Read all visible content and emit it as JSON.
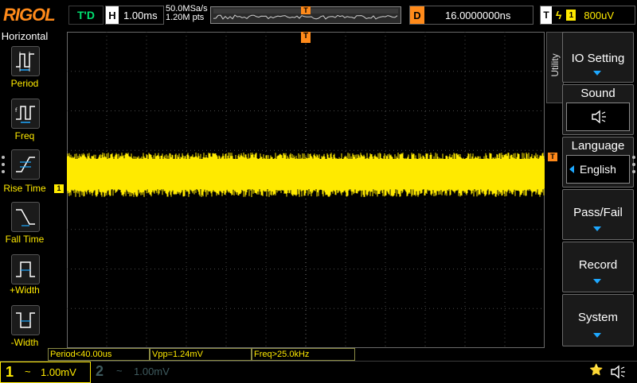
{
  "header": {
    "brand": "RIGOL",
    "run_status": "T'D",
    "timebase_tag": "H",
    "timebase": "1.00ms",
    "sample_rate": "50.0MSa/s",
    "memory_depth": "1.20M pts",
    "delay_tag": "D",
    "delay": "16.0000000ns",
    "trigger_tag": "T",
    "trigger_source": "1",
    "trigger_level": "800uV"
  },
  "measure_menu": {
    "title": "Horizontal",
    "items": [
      {
        "label": "Period",
        "icon": "period-icon"
      },
      {
        "label": "Freq",
        "icon": "frequency-icon"
      },
      {
        "label": "Rise Time",
        "icon": "rise-time-icon"
      },
      {
        "label": "Fall Time",
        "icon": "fall-time-icon"
      },
      {
        "label": "+Width",
        "icon": "positive-width-icon"
      },
      {
        "label": "-Width",
        "icon": "negative-width-icon"
      }
    ]
  },
  "display": {
    "channel_marker": "1",
    "trigger_position_marker": "T",
    "trigger_level_marker": "T",
    "trace_color": "#ffea00",
    "grid_color": "#4a4a4a",
    "grid_divisions": {
      "horizontal": 12,
      "vertical": 8
    }
  },
  "measurements": [
    {
      "text": "Period<40.00us"
    },
    {
      "text": "Vpp=1.24mV"
    },
    {
      "text": "Freq>25.0kHz"
    }
  ],
  "channels": [
    {
      "number": "1",
      "coupling": "~",
      "scale": "1.00mV",
      "active": true,
      "color": "#ffea00"
    },
    {
      "number": "2",
      "coupling": "~",
      "scale": "1.00mV",
      "active": false,
      "color": "#3e5a5e"
    }
  ],
  "utility_menu": {
    "tab_label": "Utility",
    "items": [
      {
        "label": "IO Setting",
        "has_arrow": true
      },
      {
        "label": "Sound",
        "icon": "speaker-icon"
      },
      {
        "label": "Language",
        "value": "English"
      },
      {
        "label": "Pass/Fail",
        "has_arrow": true
      },
      {
        "label": "Record",
        "has_arrow": true
      },
      {
        "label": "System",
        "has_arrow": true
      }
    ]
  },
  "status_icons": [
    "usb-icon",
    "speaker-icon"
  ]
}
